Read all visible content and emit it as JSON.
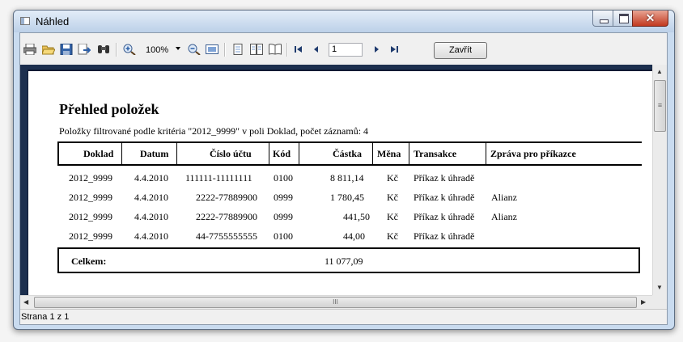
{
  "window": {
    "title": "Náhled"
  },
  "toolbar": {
    "icons": [
      "print-icon",
      "open-icon",
      "save-icon",
      "export-icon",
      "find-icon",
      "zoom-in-icon",
      "zoom-out-icon",
      "fit-page-icon",
      "single-page-icon",
      "multi-page-icon",
      "book-icon",
      "first-page-icon",
      "previous-page-icon",
      "next-page-icon",
      "last-page-icon"
    ],
    "zoom": "100%",
    "page": "1",
    "close_label": "Zavřít"
  },
  "report": {
    "title": "Přehled položek",
    "subtitle": "Položky filtrované podle kritéria \"2012_9999\" v poli Doklad,  počet záznamů: 4",
    "columns": [
      "Doklad",
      "Datum",
      "Číslo účtu",
      "Kód",
      "Částka",
      "Měna",
      "Transakce",
      "Zpráva pro příkazce"
    ],
    "rows": [
      [
        "2012_9999",
        "4.4.2010",
        "111111-11111111",
        "0100",
        "8 811,14",
        "Kč",
        "Příkaz k úhradě",
        ""
      ],
      [
        "2012_9999",
        "4.4.2010",
        "2222-77889900",
        "0999",
        "1 780,45",
        "Kč",
        "Příkaz k úhradě",
        "Alianz"
      ],
      [
        "2012_9999",
        "4.4.2010",
        "2222-77889900",
        "0999",
        "441,50",
        "Kč",
        "Příkaz k úhradě",
        "Alianz"
      ],
      [
        "2012_9999",
        "4.4.2010",
        "44-7755555555",
        "0100",
        "44,00",
        "Kč",
        "Příkaz k úhradě",
        ""
      ]
    ],
    "total_label": "Celkem:",
    "total_value": "11 077,09"
  },
  "status": {
    "text": "Strana 1 z 1"
  },
  "scroll": {
    "h_thumb_grip": "III",
    "v_thumb_grip": "≡"
  }
}
